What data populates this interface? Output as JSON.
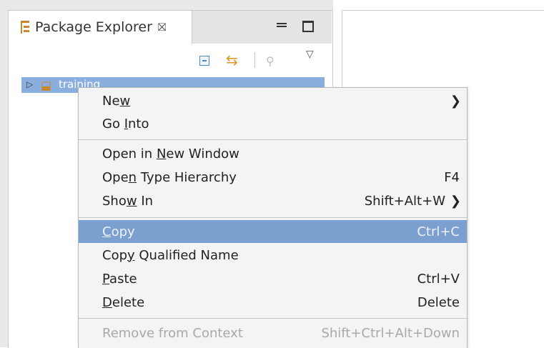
{
  "view": {
    "tab_title": "Package Explorer",
    "tab_close_glyph": "⛝",
    "tab_icon": "package-explorer-icon"
  },
  "toolbar": {
    "icons": [
      "collapse-all-icon",
      "link-with-editor-icon",
      "focus-icon",
      "view-menu-icon"
    ]
  },
  "tree": {
    "item_label": "training",
    "item_icon": "java-project-icon",
    "expanded": false
  },
  "context_menu": {
    "items": [
      {
        "pre": "Ne",
        "ul": "w",
        "post": "",
        "accel": "",
        "submenu": true
      },
      {
        "pre": "Go ",
        "ul": "I",
        "post": "nto",
        "accel": "",
        "submenu": false
      },
      {
        "pre": "Open in ",
        "ul": "N",
        "post": "ew Window",
        "accel": "",
        "submenu": false
      },
      {
        "pre": "Ope",
        "ul": "n",
        "post": " Type Hierarchy",
        "accel": "F4",
        "submenu": false
      },
      {
        "pre": "Sho",
        "ul": "w",
        "post": " In",
        "accel": "Shift+Alt+W",
        "submenu": true
      },
      {
        "pre": "",
        "ul": "C",
        "post": "opy",
        "accel": "Ctrl+C",
        "submenu": false,
        "selected": true
      },
      {
        "pre": "Cop",
        "ul": "y",
        "post": " Qualified Name",
        "accel": "",
        "submenu": false
      },
      {
        "pre": "",
        "ul": "P",
        "post": "aste",
        "accel": "Ctrl+V",
        "submenu": false
      },
      {
        "pre": "",
        "ul": "D",
        "post": "elete",
        "accel": "Delete",
        "submenu": false
      },
      {
        "pre": "Remove from Context",
        "ul": "",
        "post": "",
        "accel": "Shift+Ctrl+Alt+Down",
        "submenu": false,
        "disabled": true
      }
    ]
  },
  "colors": {
    "selection": "#7b9fcf",
    "tree_selection": "#8aaede",
    "menu_bg": "#f4f4f4"
  }
}
